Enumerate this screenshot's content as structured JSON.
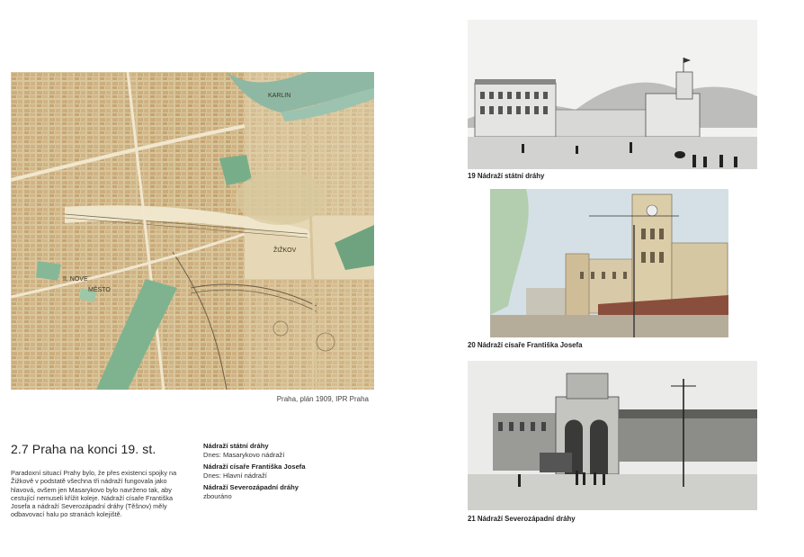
{
  "map": {
    "labels": {
      "karlin": "KARLIN",
      "zizkov": "ŽIŽKOV",
      "nove": "II. NOVE",
      "mesto": "MĚSTO"
    },
    "caption": "Praha, plán 1909, IPR Praha"
  },
  "section": {
    "title": "2.7 Praha na konci 19. st.",
    "body": "Paradoxní situací Prahy bylo, že přes existenci spojky na Žižkově v podstatě všechna tři nádraží fungovala jako hlavová, ovšem jen Masarykovo bylo navrženo tak, aby cestující nemuseli křížit koleje. Nádraží císaře Františka Josefa a nádraží Severozápadní dráhy (Těšnov) měly odbavovací halu po stranách kolejiště."
  },
  "stations": [
    {
      "name": "Nádraží státní dráhy",
      "status": "Dnes: Masarykovo nádraží"
    },
    {
      "name": "Nádraží císaře Františka Josefa",
      "status": "Dnes: Hlavní nádraží"
    },
    {
      "name": "Nádraží Severozápadní dráhy",
      "status": "zbouráno"
    }
  ],
  "photos": [
    {
      "caption": "19 Nádraží státní dráhy"
    },
    {
      "caption": "20 Nádraží císaře Františka Josefa"
    },
    {
      "caption": "21 Nádraží Severozápadní dráhy"
    }
  ]
}
